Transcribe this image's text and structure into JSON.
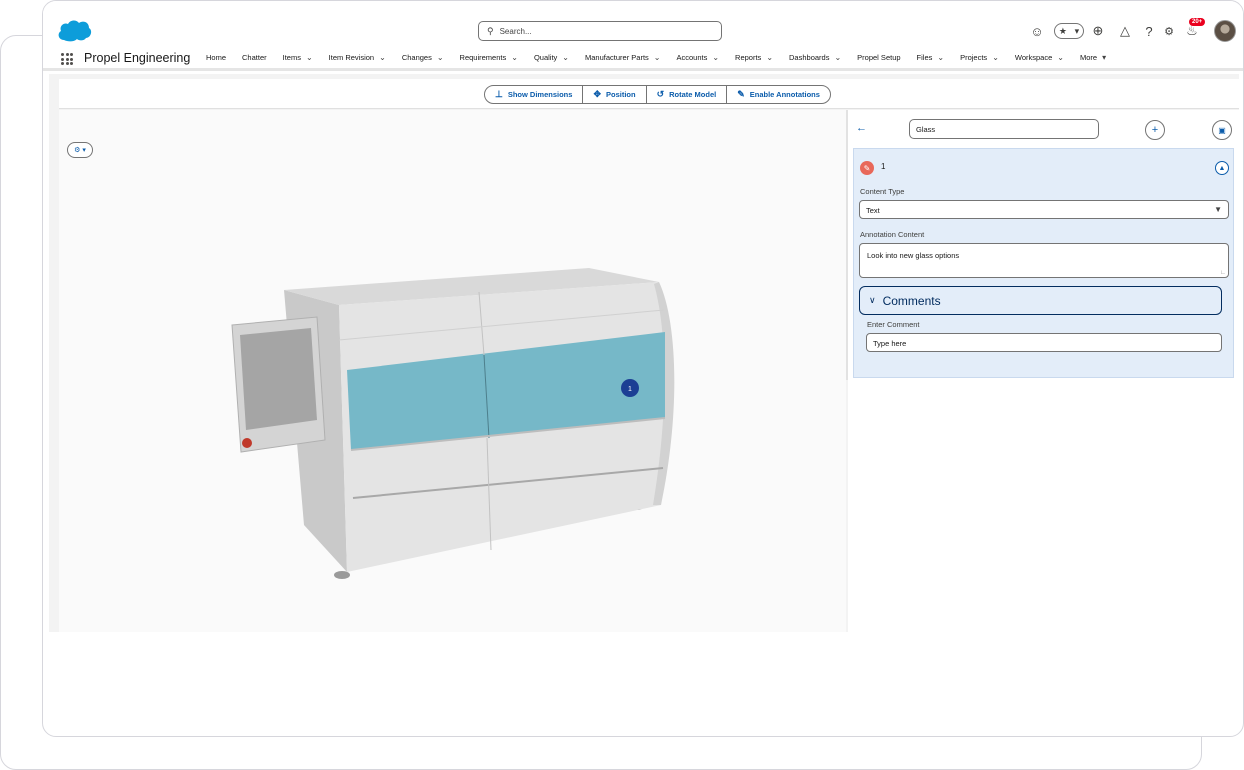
{
  "app": {
    "name": "Propel Engineering"
  },
  "search": {
    "placeholder": "Search..."
  },
  "notifications": {
    "badge": "20+"
  },
  "nav": {
    "items": [
      {
        "label": "Home",
        "dropdown": false
      },
      {
        "label": "Chatter",
        "dropdown": false
      },
      {
        "label": "Items",
        "dropdown": true
      },
      {
        "label": "Item Revision",
        "dropdown": true
      },
      {
        "label": "Changes",
        "dropdown": true
      },
      {
        "label": "Requirements",
        "dropdown": true
      },
      {
        "label": "Quality",
        "dropdown": true
      },
      {
        "label": "Manufacturer Parts",
        "dropdown": true
      },
      {
        "label": "Accounts",
        "dropdown": true
      },
      {
        "label": "Reports",
        "dropdown": true
      },
      {
        "label": "Dashboards",
        "dropdown": true
      },
      {
        "label": "Propel Setup",
        "dropdown": false
      },
      {
        "label": "Files",
        "dropdown": true
      },
      {
        "label": "Projects",
        "dropdown": true
      },
      {
        "label": "Workspace",
        "dropdown": true
      },
      {
        "label": "More",
        "dropdown": true
      }
    ]
  },
  "toolbar": {
    "show_dimensions": "Show Dimensions",
    "position": "Position",
    "rotate_model": "Rotate Model",
    "enable_annotations": "Enable Annotations"
  },
  "viewer": {
    "annotation_marker": "1"
  },
  "panel": {
    "annotation_name": "Glass",
    "annotation_number": "1",
    "content_type_label": "Content Type",
    "content_type_value": "Text",
    "annotation_content_label": "Annotation Content",
    "annotation_content_value": "Look into new glass options",
    "comments_title": "Comments",
    "enter_comment_label": "Enter Comment",
    "comment_placeholder": "Type here"
  },
  "colors": {
    "brand_blue": "#0b5cab",
    "salesforce_cloud": "#0d9dda",
    "glass_panel": "#76b8c8",
    "annotation_marker": "#1c3f94",
    "card_background": "#e3edf9"
  }
}
